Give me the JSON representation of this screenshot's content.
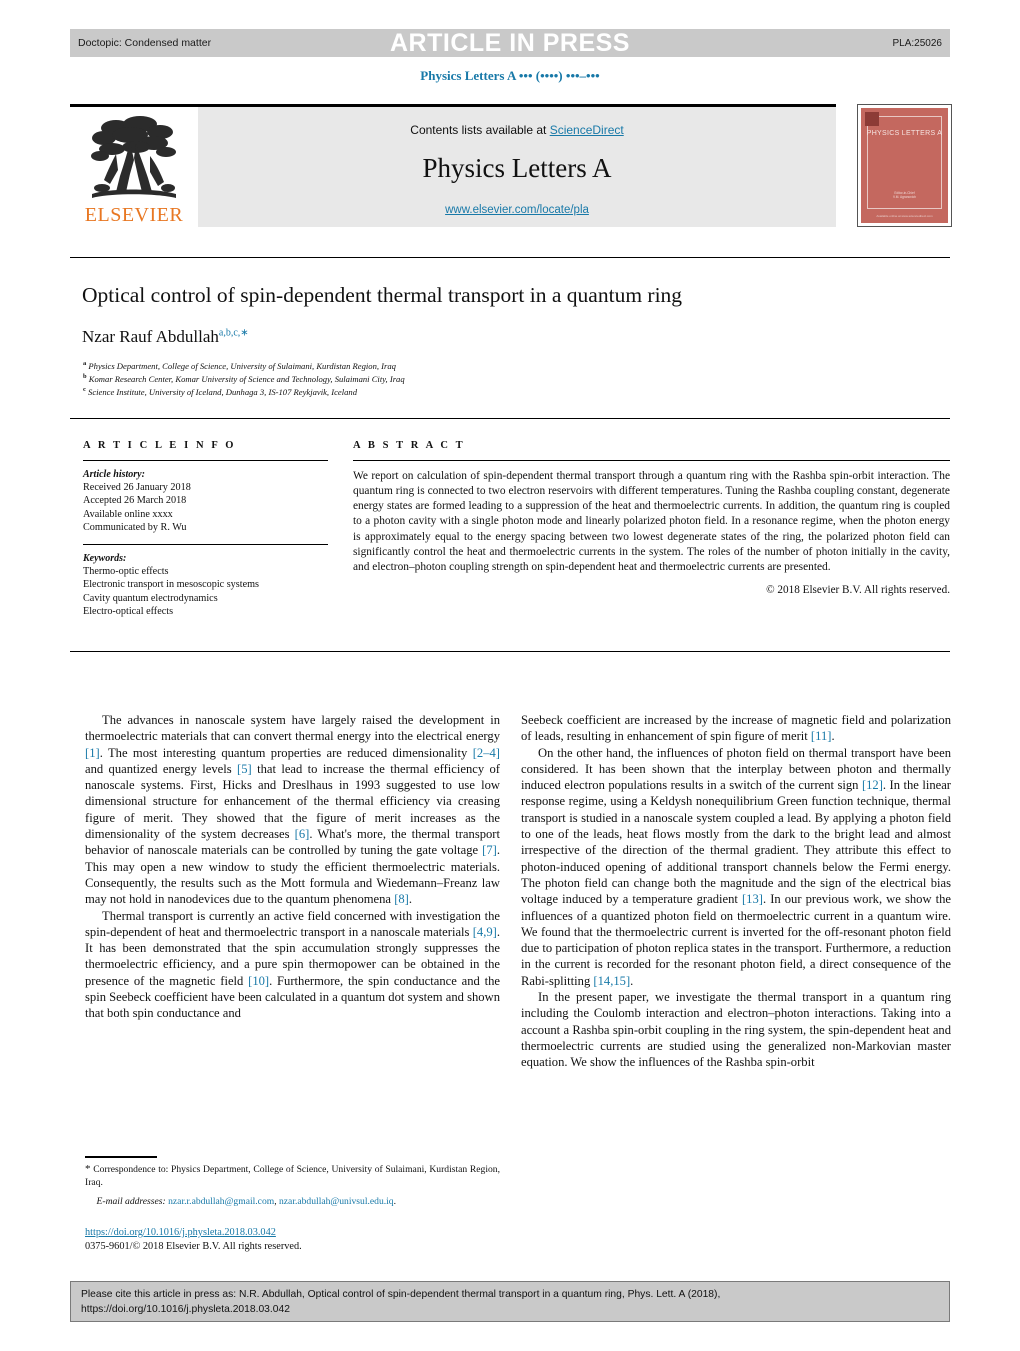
{
  "header": {
    "doctopic": "Doctopic: Condensed matter",
    "banner": "ARTICLE IN PRESS",
    "code": "PLA:25026",
    "journal_ref": "Physics Letters A ••• (••••) •••–•••"
  },
  "masthead": {
    "contents_prefix": "Contents lists available at ",
    "sciencedirect": "ScienceDirect",
    "journal_title": "Physics Letters A",
    "url": "www.elsevier.com/locate/pla",
    "publisher": "ELSEVIER",
    "cover_title": "PHYSICS LETTERS A",
    "cover_foot1": "Editor-in-Chief\nV.M. Agranovich",
    "cover_foot2": "Available online at www.sciencedirect.com"
  },
  "article": {
    "title": "Optical control of spin-dependent thermal transport in a quantum ring",
    "author": "Nzar Rauf Abdullah",
    "author_marks": "a,b,c,∗",
    "affiliations": [
      {
        "mark": "a",
        "text": "Physics Department, College of Science, University of Sulaimani, Kurdistan Region, Iraq"
      },
      {
        "mark": "b",
        "text": "Komar Research Center, Komar University of Science and Technology, Sulaimani City, Iraq"
      },
      {
        "mark": "c",
        "text": "Science Institute, University of Iceland, Dunhaga 3, IS-107 Reykjavik, Iceland"
      }
    ]
  },
  "info": {
    "heading": "A R T I C L E    I N F O",
    "history_label": "Article history:",
    "history": [
      "Received 26 January 2018",
      "Accepted 26 March 2018",
      "Available online xxxx",
      "Communicated by R. Wu"
    ],
    "keywords_label": "Keywords:",
    "keywords": [
      "Thermo-optic effects",
      "Electronic transport in mesoscopic systems",
      "Cavity quantum electrodynamics",
      "Electro-optical effects"
    ]
  },
  "abstract": {
    "heading": "A B S T R A C T",
    "text": "We report on calculation of spin-dependent thermal transport through a quantum ring with the Rashba spin-orbit interaction. The quantum ring is connected to two electron reservoirs with different temperatures. Tuning the Rashba coupling constant, degenerate energy states are formed leading to a suppression of the heat and thermoelectric currents. In addition, the quantum ring is coupled to a photon cavity with a single photon mode and linearly polarized photon field. In a resonance regime, when the photon energy is approximately equal to the energy spacing between two lowest degenerate states of the ring, the polarized photon field can significantly control the heat and thermoelectric currents in the system. The roles of the number of photon initially in the cavity, and electron–photon coupling strength on spin-dependent heat and thermoelectric currents are presented.",
    "copyright": "© 2018 Elsevier B.V. All rights reserved."
  },
  "body": {
    "left": [
      "The advances in nanoscale system have largely raised the development in thermoelectric materials that can convert thermal energy into the electrical energy [1]. The most interesting quantum properties are reduced dimensionality [2–4] and quantized energy levels [5] that lead to increase the thermal efficiency of nanoscale systems. First, Hicks and Dreslhaus in 1993 suggested to use low dimensional structure for enhancement of the thermal efficiency via creasing figure of merit. They showed that the figure of merit increases as the dimensionality of the system decreases [6]. What's more, the thermal transport behavior of nanoscale materials can be controlled by tuning the gate voltage [7]. This may open a new window to study the efficient thermoelectric materials. Consequently, the results such as the Mott formula and Wiedemann–Freanz law may not hold in nanodevices due to the quantum phenomena [8].",
      "Thermal transport is currently an active field concerned with investigation the spin-dependent of heat and thermoelectric transport in a nanoscale materials [4,9]. It has been demonstrated that the spin accumulation strongly suppresses the thermoelectric efficiency, and a pure spin thermopower can be obtained in the presence of the magnetic field [10]. Furthermore, the spin conductance and the spin Seebeck coefficient have been calculated in a quantum dot system and shown that both spin conductance and"
    ],
    "right": [
      "Seebeck coefficient are increased by the increase of magnetic field and polarization of leads, resulting in enhancement of spin figure of merit [11].",
      "On the other hand, the influences of photon field on thermal transport have been considered. It has been shown that the interplay between photon and thermally induced electron populations results in a switch of the current sign [12]. In the linear response regime, using a Keldysh nonequilibrium Green function technique, thermal transport is studied in a nanoscale system coupled a lead. By applying a photon field to one of the leads, heat flows mostly from the dark to the bright lead and almost irrespective of the direction of the thermal gradient. They attribute this effect to photon-induced opening of additional transport channels below the Fermi energy. The photon field can change both the magnitude and the sign of the electrical bias voltage induced by a temperature gradient [13]. In our previous work, we show the influences of a quantized photon field on thermoelectric current in a quantum wire. We found that the thermoelectric current is inverted for the off-resonant photon field due to participation of photon replica states in the transport. Furthermore, a reduction in the current is recorded for the resonant photon field, a direct consequence of the Rabi-splitting [14,15].",
      "In the present paper, we investigate the thermal transport in a quantum ring including the Coulomb interaction and electron–photon interactions. Taking into a account a Rashba spin-orbit coupling in the ring system, the spin-dependent heat and thermoelectric currents are studied using the generalized non-Markovian master equation. We show the influences of the Rashba spin-orbit"
    ]
  },
  "footnotes": {
    "correspondence": "Correspondence to: Physics Department, College of Science, University of Sulaimani, Kurdistan Region, Iraq.",
    "email_label": "E-mail addresses:",
    "email1": "nzar.r.abdullah@gmail.com",
    "email2": "nzar.abdullah@univsul.edu.iq",
    "doi": "https://doi.org/10.1016/j.physleta.2018.03.042",
    "issn": "0375-9601/© 2018 Elsevier B.V. All rights reserved."
  },
  "footer": {
    "cite_line1": "Please cite this article in press as: N.R. Abdullah, Optical control of spin-dependent thermal transport in a quantum ring, Phys. Lett. A (2018),",
    "cite_line2": "https://doi.org/10.1016/j.physleta.2018.03.042"
  },
  "colors": {
    "link": "#1879a8",
    "bar": "#c9c9c9",
    "masthead_bg": "#e8e8e8",
    "elsevier_orange": "#e87722",
    "cover_red": "#c4685f"
  }
}
